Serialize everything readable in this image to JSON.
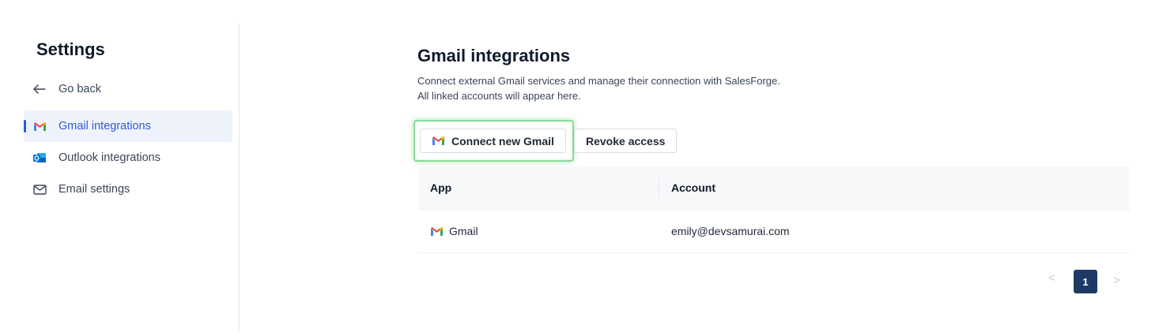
{
  "sidebar": {
    "title": "Settings",
    "items": [
      {
        "label": "Go back",
        "icon": "arrow-left-icon"
      },
      {
        "label": "Gmail integrations",
        "icon": "gmail-icon",
        "active": true
      },
      {
        "label": "Outlook integrations",
        "icon": "outlook-icon"
      },
      {
        "label": "Email settings",
        "icon": "envelope-icon"
      }
    ]
  },
  "main": {
    "title": "Gmail integrations",
    "description_line1": "Connect external Gmail services and manage their connection with SalesForge.",
    "description_line2": "All linked accounts will appear here.",
    "connect_button": "Connect new Gmail",
    "revoke_button": "Revoke access",
    "table": {
      "columns": [
        "App",
        "Account"
      ],
      "rows": [
        {
          "app": "Gmail",
          "account": "emily@devsamurai.com"
        }
      ]
    },
    "pagination": {
      "prev": "<",
      "current_page": "1",
      "next": ">"
    }
  },
  "colors": {
    "accent": "#2f5bd8",
    "page_button": "#1d3a66",
    "highlight": "#8ed99a"
  }
}
